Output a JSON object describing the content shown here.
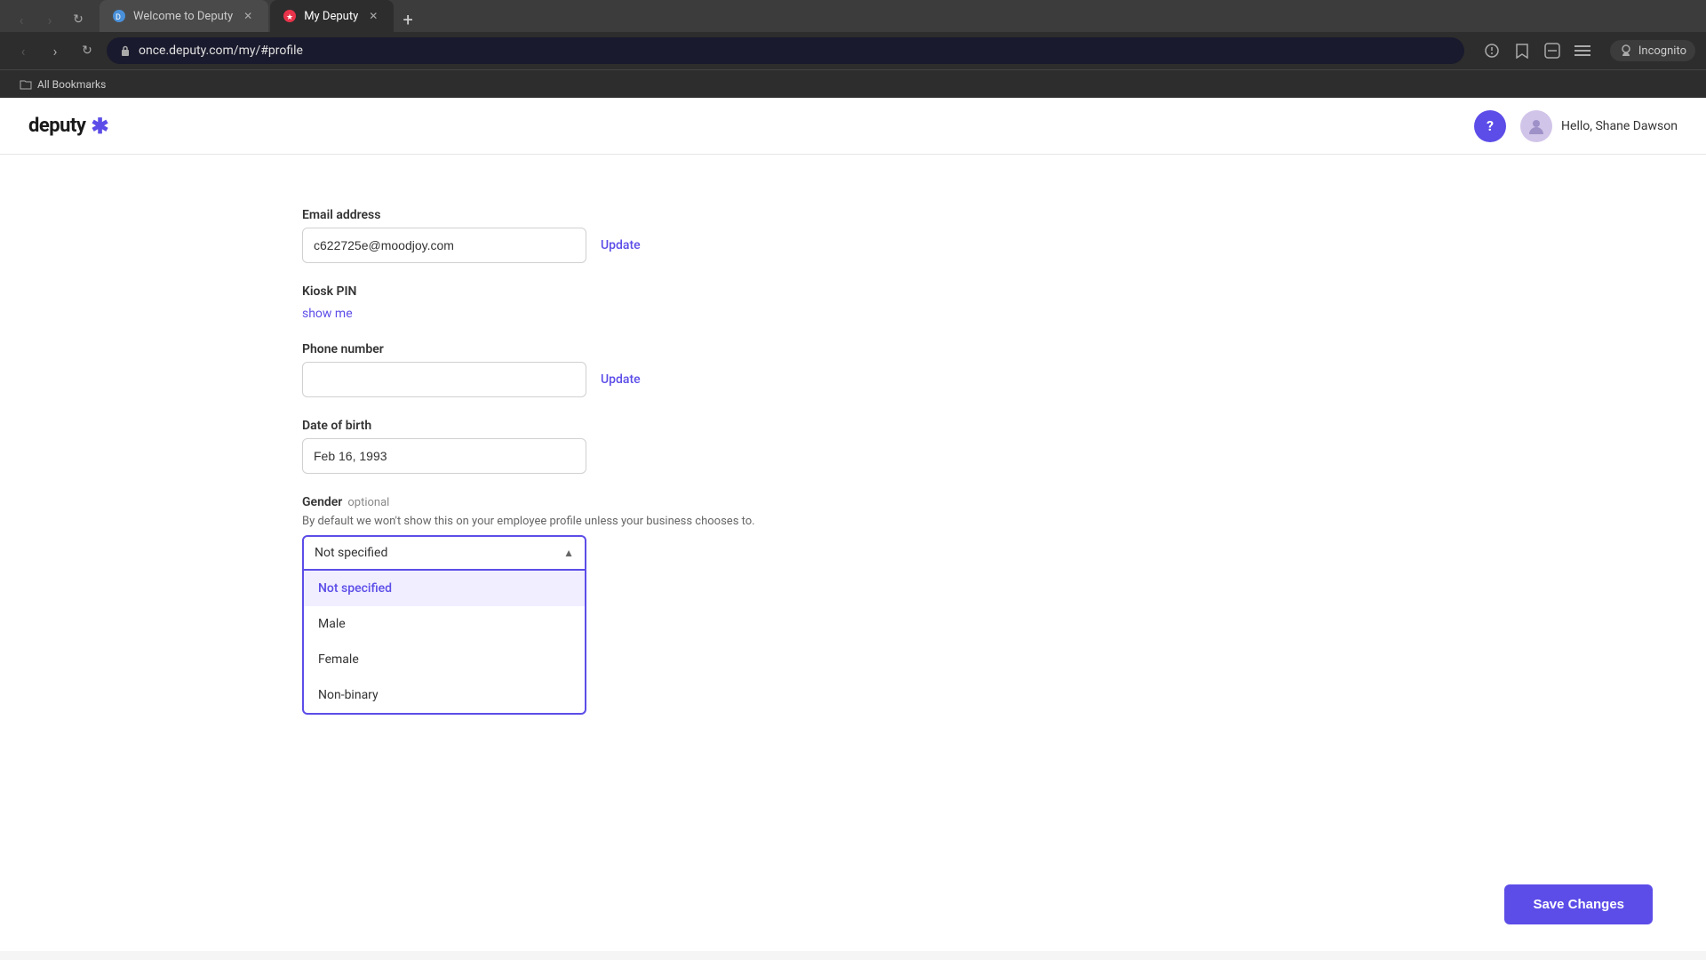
{
  "browser": {
    "tabs": [
      {
        "id": "tab-1",
        "label": "Welcome to Deputy",
        "favicon": "🏢",
        "active": false
      },
      {
        "id": "tab-2",
        "label": "My Deputy",
        "favicon": "⭐",
        "active": true
      }
    ],
    "address": "once.deputy.com/my/#profile",
    "incognito_label": "Incognito",
    "new_tab_label": "+",
    "bookmark_items": [
      "All Bookmarks"
    ]
  },
  "nav": {
    "logo_text": "deputy",
    "logo_asterisk": "✱",
    "help_label": "?",
    "user_greeting": "Hello, Shane Dawson"
  },
  "profile": {
    "email_label": "Email address",
    "email_value": "c622725e@moodjoy.com",
    "email_update": "Update",
    "kiosk_label": "Kiosk PIN",
    "kiosk_show": "show me",
    "phone_label": "Phone number",
    "phone_value": "",
    "phone_update": "Update",
    "dob_label": "Date of birth",
    "dob_value": "Feb 16, 1993",
    "gender_label": "Gender",
    "gender_optional": "optional",
    "gender_description": "By default we won't show this on your employee profile unless your business chooses to.",
    "gender_selected": "Not specified",
    "gender_options": [
      {
        "value": "not_specified",
        "label": "Not specified",
        "selected": true
      },
      {
        "value": "male",
        "label": "Male",
        "selected": false
      },
      {
        "value": "female",
        "label": "Female",
        "selected": false
      },
      {
        "value": "non_binary",
        "label": "Non-binary",
        "selected": false
      }
    ]
  },
  "actions": {
    "save_label": "Save Changes"
  }
}
